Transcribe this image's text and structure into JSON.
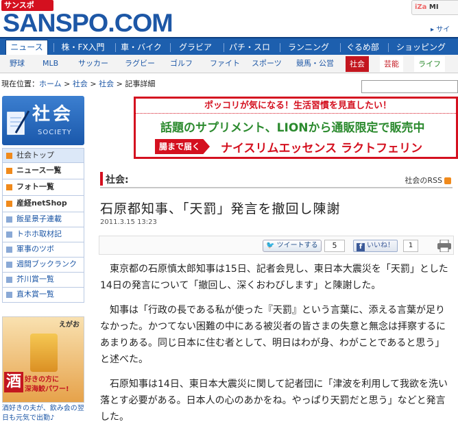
{
  "header": {
    "sansspo_badge": "サンスポ",
    "logo": "SANSPO.COM",
    "iza": "iZa",
    "iza_suffix": "MI",
    "site_search": "サイ"
  },
  "main_nav": [
    {
      "label": "ニュース",
      "active": true
    },
    {
      "label": "株・FX入門"
    },
    {
      "label": "車・バイク"
    },
    {
      "label": "グラビア"
    },
    {
      "label": "パチ・スロ"
    },
    {
      "label": "ランニング"
    },
    {
      "label": "ぐるめ部"
    },
    {
      "label": "ショッピング"
    }
  ],
  "sub_nav": [
    {
      "label": "野球"
    },
    {
      "label": "MLB"
    },
    {
      "label": "サッカー"
    },
    {
      "label": "ラグビー"
    },
    {
      "label": "ゴルフ"
    },
    {
      "label": "ファイト"
    },
    {
      "label": "スポーツ"
    },
    {
      "label": "競馬・公営"
    },
    {
      "label": "社会",
      "bg": "#c3161f",
      "color": "#ffffff"
    },
    {
      "label": "芸能",
      "bg": "#ffffff",
      "color": "#c3161f"
    },
    {
      "label": "ライフ",
      "bg": "#ffffff",
      "color": "#2b8a2e"
    }
  ],
  "breadcrumb": {
    "prefix": "現在位置：",
    "items": [
      "ホーム",
      "社会",
      "社会"
    ],
    "current": "記事詳細",
    "sep": " > "
  },
  "sidebar": {
    "hero_title": "社会",
    "hero_sub": "SOCIETY",
    "items": [
      {
        "label": "社会トップ",
        "kind": "cur"
      },
      {
        "label": "ニュース一覧",
        "kind": "strong"
      },
      {
        "label": "フォト一覧",
        "kind": "strong"
      },
      {
        "label": "産経netShop",
        "kind": "strong"
      },
      {
        "label": "飯星景子連載",
        "kind": "blue"
      },
      {
        "label": "トホホ取材記",
        "kind": "blue"
      },
      {
        "label": "軍事のツボ",
        "kind": "blue"
      },
      {
        "label": "週間ブックランク",
        "kind": "blue"
      },
      {
        "label": "芥川賞一覧",
        "kind": "blue"
      },
      {
        "label": "直木賞一覧",
        "kind": "blue"
      }
    ],
    "ad": {
      "corner": "えがお",
      "kanji": "酒",
      "line1": "好きの方に",
      "line2": "深海鮫パワー!",
      "caption": "酒好きの夫が、飲み会の翌日も元気で出勤♪"
    }
  },
  "banner": {
    "top": "ポッコリが気になる！生活習慣を見直したい！",
    "mid": "話題のサプリメント、LIONから通販限定で販売中",
    "tag": "腸まで届く",
    "product": "ナイスリムエッセンス ラクトフェリン"
  },
  "article": {
    "section": "社会:",
    "rss": "社会のRSS",
    "headline": "石原都知事、「天罰」発言を撤回し陳謝",
    "date": "2011.3.15 13:23",
    "tweet_label": "ツイートする",
    "tweet_count": "5",
    "like_label": "いいね！",
    "like_count": "1",
    "paragraphs": [
      "東京都の石原慎太郎知事は15日、記者会見し、東日本大震災を「天罰」とした14日の発言について「撤回し、深くおわびします」と陳謝した。",
      "知事は「行政の長である私が使った『天罰』という言葉に、添える言葉が足りなかった。かつてない困難の中にある被災者の皆さまの失意と無念は拝察するにあまりある。同じ日本に住む者として、明日はわが身、わがことであると思う」と述べた。",
      "石原知事は14日、東日本大震災に関して記者団に「津波を利用して我欲を洗い落とす必要がある。日本人の心のあかをね。やっぱり天罰だと思う」などと発言した。"
    ]
  },
  "colors": {
    "brand_blue": "#1d57a6",
    "nav_blue": "#1d5fae",
    "accent_red": "#d4101f",
    "banner_green": "#2b8a2e"
  }
}
